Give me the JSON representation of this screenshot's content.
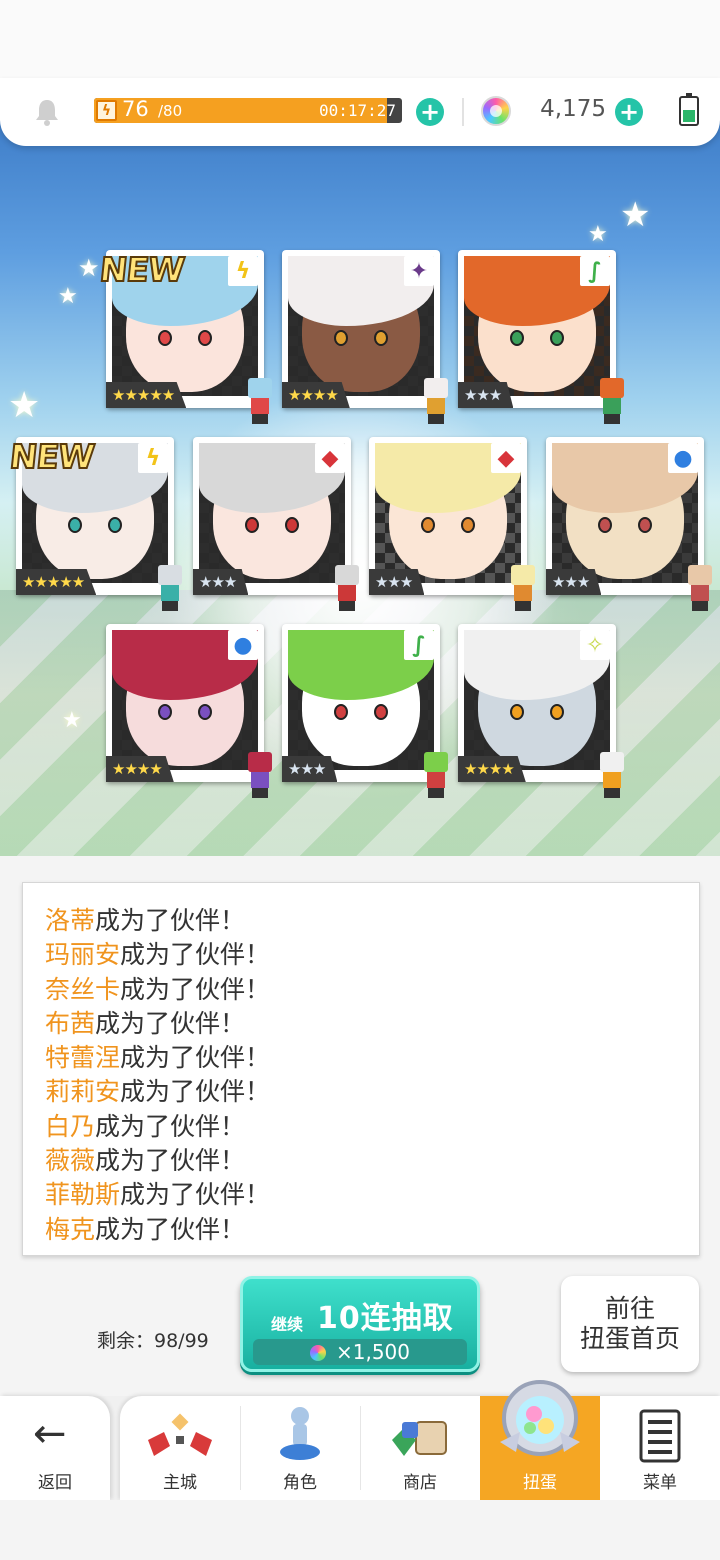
{
  "status_bar": {
    "stamina_current": "76",
    "stamina_max": "/80",
    "stamina_fraction": 0.95,
    "stamina_timer": "00:17:27",
    "gem_count": "4,175",
    "icons": [
      "bell-icon",
      "lightning-icon",
      "plus-icon",
      "rainbow-gem-icon",
      "battery-icon"
    ]
  },
  "result_cards": [
    {
      "new": "NEW",
      "element": "lightning",
      "rarity_stars": 5,
      "stars_text": "★★★★★"
    },
    {
      "element": "dark",
      "rarity_stars": 4,
      "stars_text": "★★★★"
    },
    {
      "element": "wind",
      "rarity_stars": 3,
      "stars_text": "★★★"
    },
    {
      "new": "NEW",
      "element": "lightning",
      "rarity_stars": 5,
      "stars_text": "★★★★★"
    },
    {
      "element": "fire",
      "rarity_stars": 3,
      "stars_text": "★★★"
    },
    {
      "element": "fire",
      "rarity_stars": 3,
      "stars_text": "★★★"
    },
    {
      "element": "water",
      "rarity_stars": 3,
      "stars_text": "★★★"
    },
    {
      "element": "water",
      "rarity_stars": 4,
      "stars_text": "★★★★"
    },
    {
      "element": "wind",
      "rarity_stars": 3,
      "stars_text": "★★★"
    },
    {
      "element": "light",
      "rarity_stars": 4,
      "stars_text": "★★★★"
    }
  ],
  "log": {
    "suffix": "成为了伙伴！",
    "names": [
      "洛蒂",
      "玛丽安",
      "奈丝卡",
      "布茜",
      "特蕾涅",
      "莉莉安",
      "白乃",
      "薇薇",
      "菲勒斯",
      "梅克"
    ]
  },
  "controls": {
    "remaining_label": "剩余：98/99",
    "pull_continue": "继续",
    "pull_label": "10连抽取",
    "pull_cost": "×1,500",
    "home_line1": "前往",
    "home_line2": "扭蛋首页"
  },
  "nav": {
    "back_label": "返回",
    "tabs": [
      {
        "label": "主城",
        "icon": "castle-icon"
      },
      {
        "label": "角色",
        "icon": "character-icon"
      },
      {
        "label": "商店",
        "icon": "shop-icon"
      },
      {
        "label": "扭蛋",
        "icon": "gacha-icon",
        "active": true
      },
      {
        "label": "菜单",
        "icon": "menu-icon"
      }
    ]
  },
  "colors": {
    "accent_orange": "#f5a623",
    "name_orange": "#f0941e",
    "teal": "#25c4a8"
  }
}
